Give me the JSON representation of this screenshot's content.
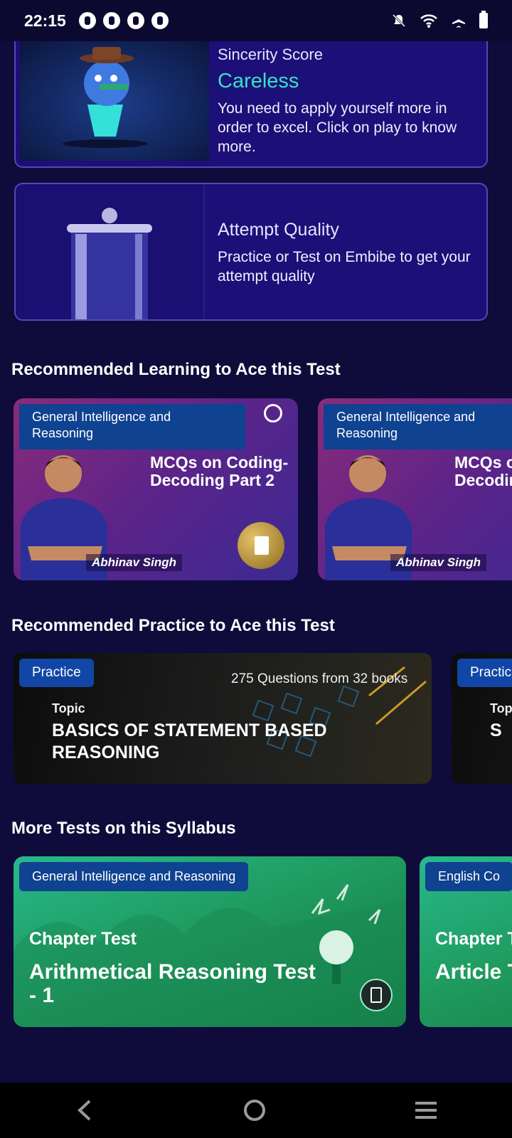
{
  "status_bar": {
    "time": "22:15"
  },
  "score_card": {
    "label": "Sincerity Score",
    "value": "Careless",
    "description": "You need to apply yourself more in order to excel. Click on play to know more."
  },
  "attempt_card": {
    "label": "Attempt Quality",
    "description": "Practice or Test on Embibe to get your attempt quality"
  },
  "sections": {
    "learning": "Recommended Learning to Ace this Test",
    "practice": "Recommended Practice to Ace this Test",
    "tests": "More Tests on this Syllabus"
  },
  "learning_cards": [
    {
      "subject": "General Intelligence and Reasoning",
      "title": "MCQs on Coding-Decoding Part 2",
      "author": "Abhinav Singh"
    },
    {
      "subject": "General Intelligence and Reasoning",
      "title": "MCQs on Coding-Decoding",
      "author": "Abhinav Singh"
    }
  ],
  "practice_cards": [
    {
      "tag": "Practice",
      "count": "275 Questions from 32 books",
      "topic_label": "Topic",
      "topic": "BASICS OF STATEMENT BASED REASONING"
    },
    {
      "tag": "Practice",
      "count": "",
      "topic_label": "Topic",
      "topic": "S"
    }
  ],
  "test_cards": [
    {
      "subject": "General Intelligence and Reasoning",
      "type": "Chapter Test",
      "name": "Arithmetical Reasoning Test - 1"
    },
    {
      "subject": "English Co",
      "type": "Chapter Test",
      "name": "Article Test -"
    }
  ],
  "nav": {
    "back": "‹",
    "home": "○",
    "menu": "≡"
  }
}
